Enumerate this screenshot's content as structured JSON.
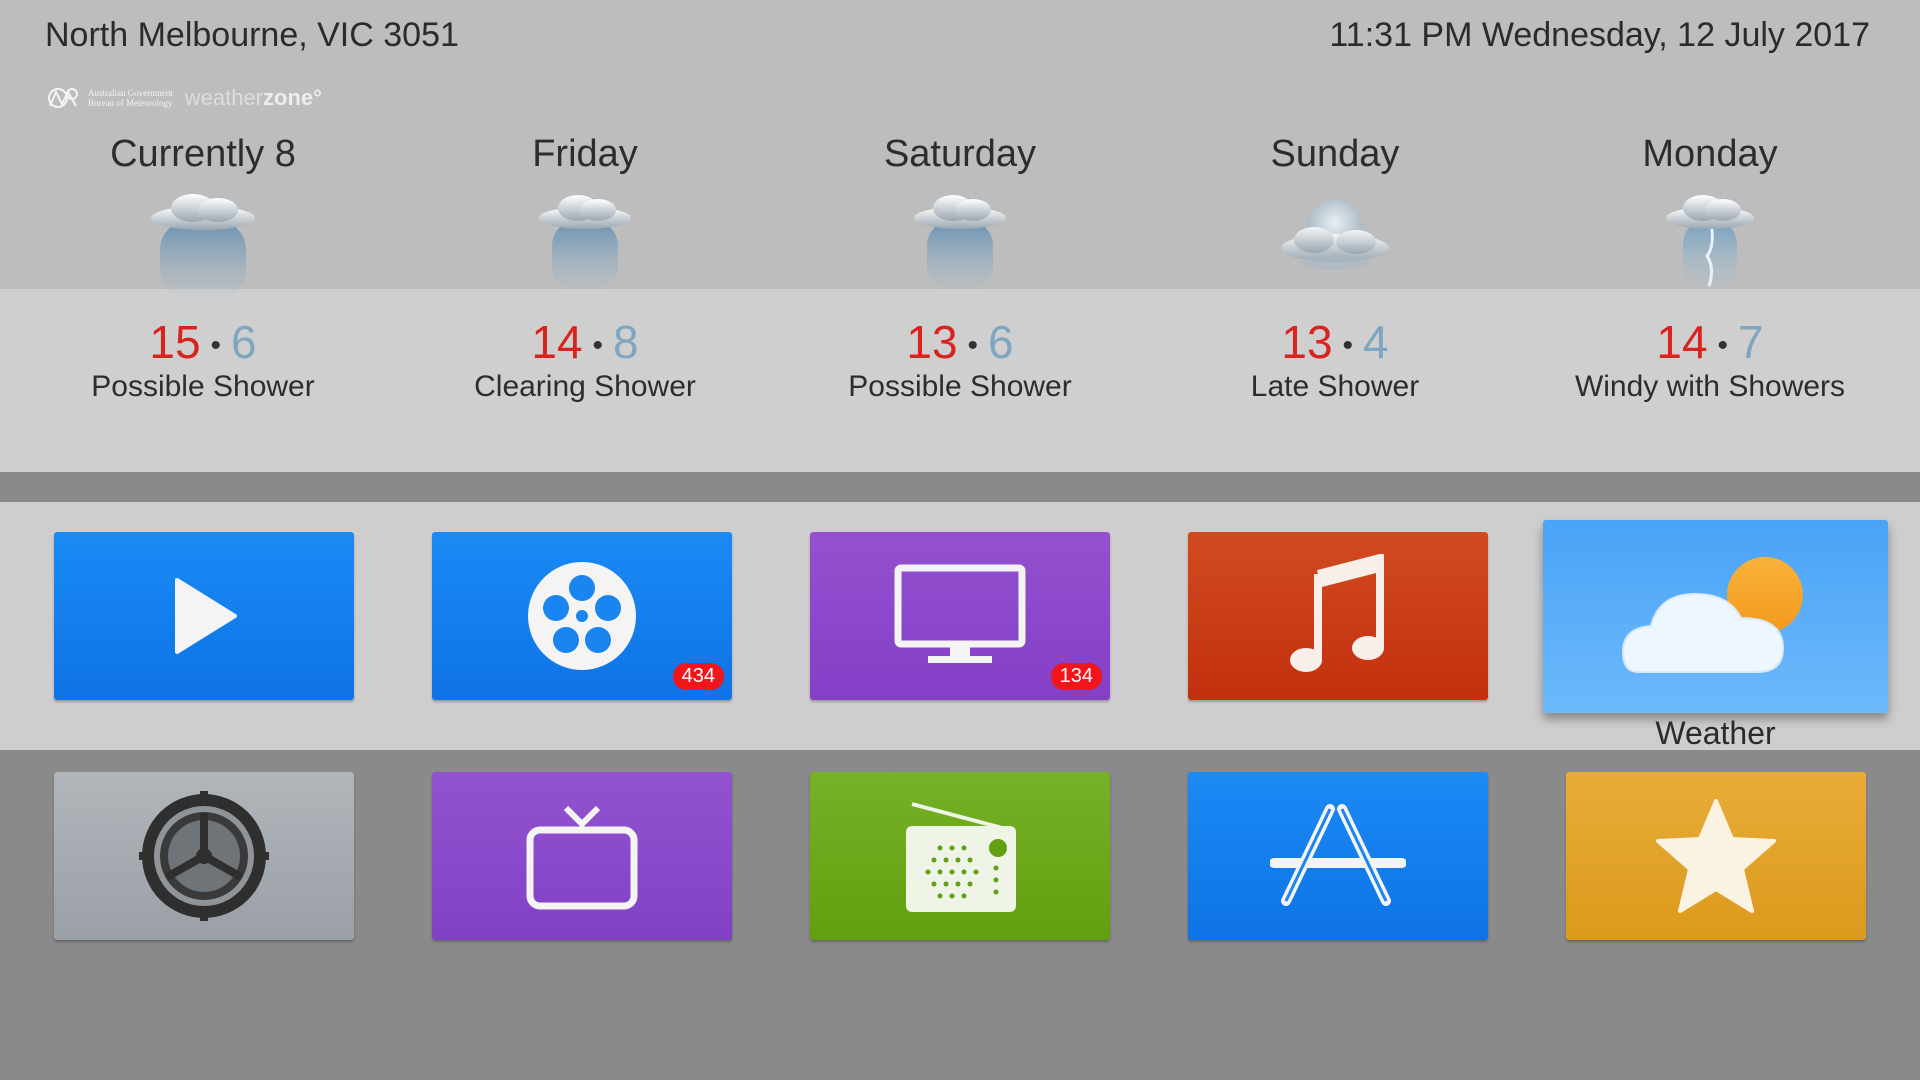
{
  "header": {
    "location": "North Melbourne, VIC 3051",
    "datetime": "11:31 PM Wednesday, 12 July 2017"
  },
  "logos": {
    "bom_line1": "Australian Government",
    "bom_line2": "Bureau of Meteorology",
    "wz_part1": "weather",
    "wz_part2": "zone°"
  },
  "forecast": [
    {
      "day": "Currently 8",
      "max": "15",
      "sep": "•",
      "min": "6",
      "desc": "Possible Shower",
      "icon": "rain-cloud-icon"
    },
    {
      "day": "Friday",
      "max": "14",
      "sep": "•",
      "min": "8",
      "desc": "Clearing Shower",
      "icon": "rain-cloud-icon"
    },
    {
      "day": "Saturday",
      "max": "13",
      "sep": "•",
      "min": "6",
      "desc": "Possible Shower",
      "icon": "rain-cloud-icon"
    },
    {
      "day": "Sunday",
      "max": "13",
      "sep": "•",
      "min": "4",
      "desc": "Late Shower",
      "icon": "cloud-moon-icon"
    },
    {
      "day": "Monday",
      "max": "14",
      "sep": "•",
      "min": "7",
      "desc": "Windy with Showers",
      "icon": "windy-rain-icon"
    }
  ],
  "apps_row1": [
    {
      "name": "Videos",
      "badge": "",
      "color": "#1a83f0"
    },
    {
      "name": "Movies",
      "badge": "434",
      "color": "#1a83f0"
    },
    {
      "name": "TV Shows",
      "badge": "134",
      "color": "#8e4fce"
    },
    {
      "name": "Music",
      "badge": "",
      "color": "#d1401c"
    },
    {
      "name": "Weather",
      "badge": "",
      "color": "#4aa6f7"
    }
  ],
  "apps_row2": [
    {
      "name": "Settings",
      "color": "#a3a8ad"
    },
    {
      "name": "Live TV",
      "color": "#8a4fcc"
    },
    {
      "name": "Radio",
      "color": "#6aa81e"
    },
    {
      "name": "App Store",
      "color": "#1a83f0"
    },
    {
      "name": "Favourites",
      "color": "#e3a72e"
    }
  ],
  "focused_label": "Weather",
  "colors": {
    "max_temp": "#d8231f",
    "min_temp": "#7fa6c0",
    "badge": "#f0161b"
  }
}
